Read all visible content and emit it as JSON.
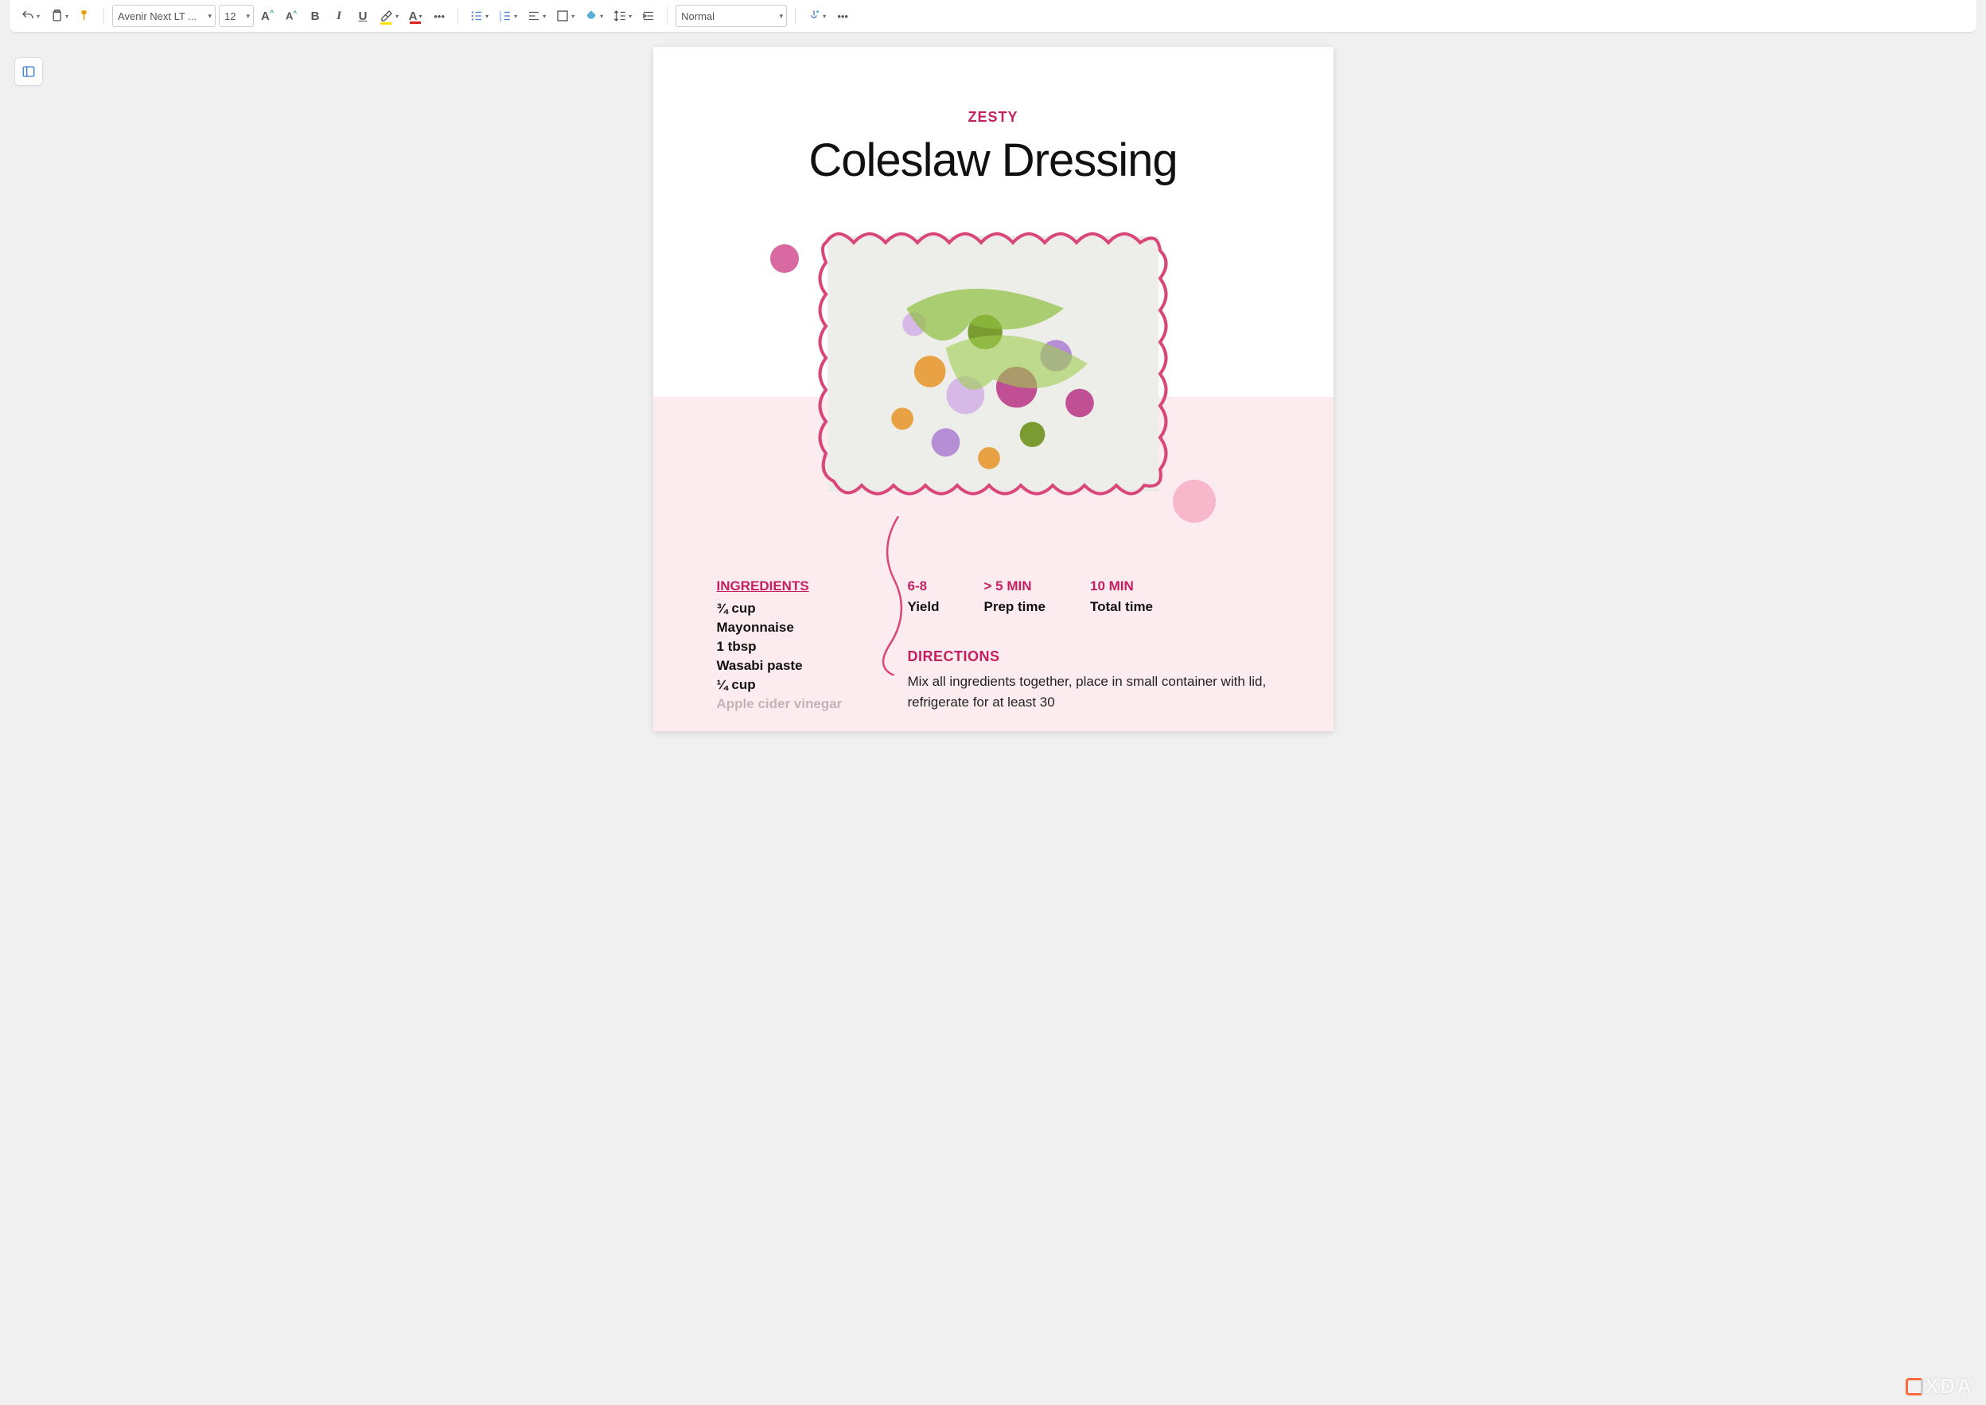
{
  "toolbar": {
    "font_name": "Avenir Next LT ...",
    "font_size": "12",
    "style_select": "Normal"
  },
  "document": {
    "kicker": "ZESTY",
    "title": "Coleslaw Dressing",
    "ingredients": {
      "heading": "INGREDIENTS",
      "lines": [
        "¾ cup",
        "Mayonnaise",
        "1 tbsp",
        "Wasabi paste",
        "¼ cup",
        "Apple cider vinegar"
      ]
    },
    "stats": [
      {
        "value": "6-8",
        "label": "Yield"
      },
      {
        "value": "> 5 MIN",
        "label": "Prep time"
      },
      {
        "value": "10 MIN",
        "label": "Total time"
      }
    ],
    "directions": {
      "heading": "DIRECTIONS",
      "body": "Mix all ingredients together, place in small container with lid, refrigerate for at least 30"
    }
  },
  "watermark": "XDA"
}
